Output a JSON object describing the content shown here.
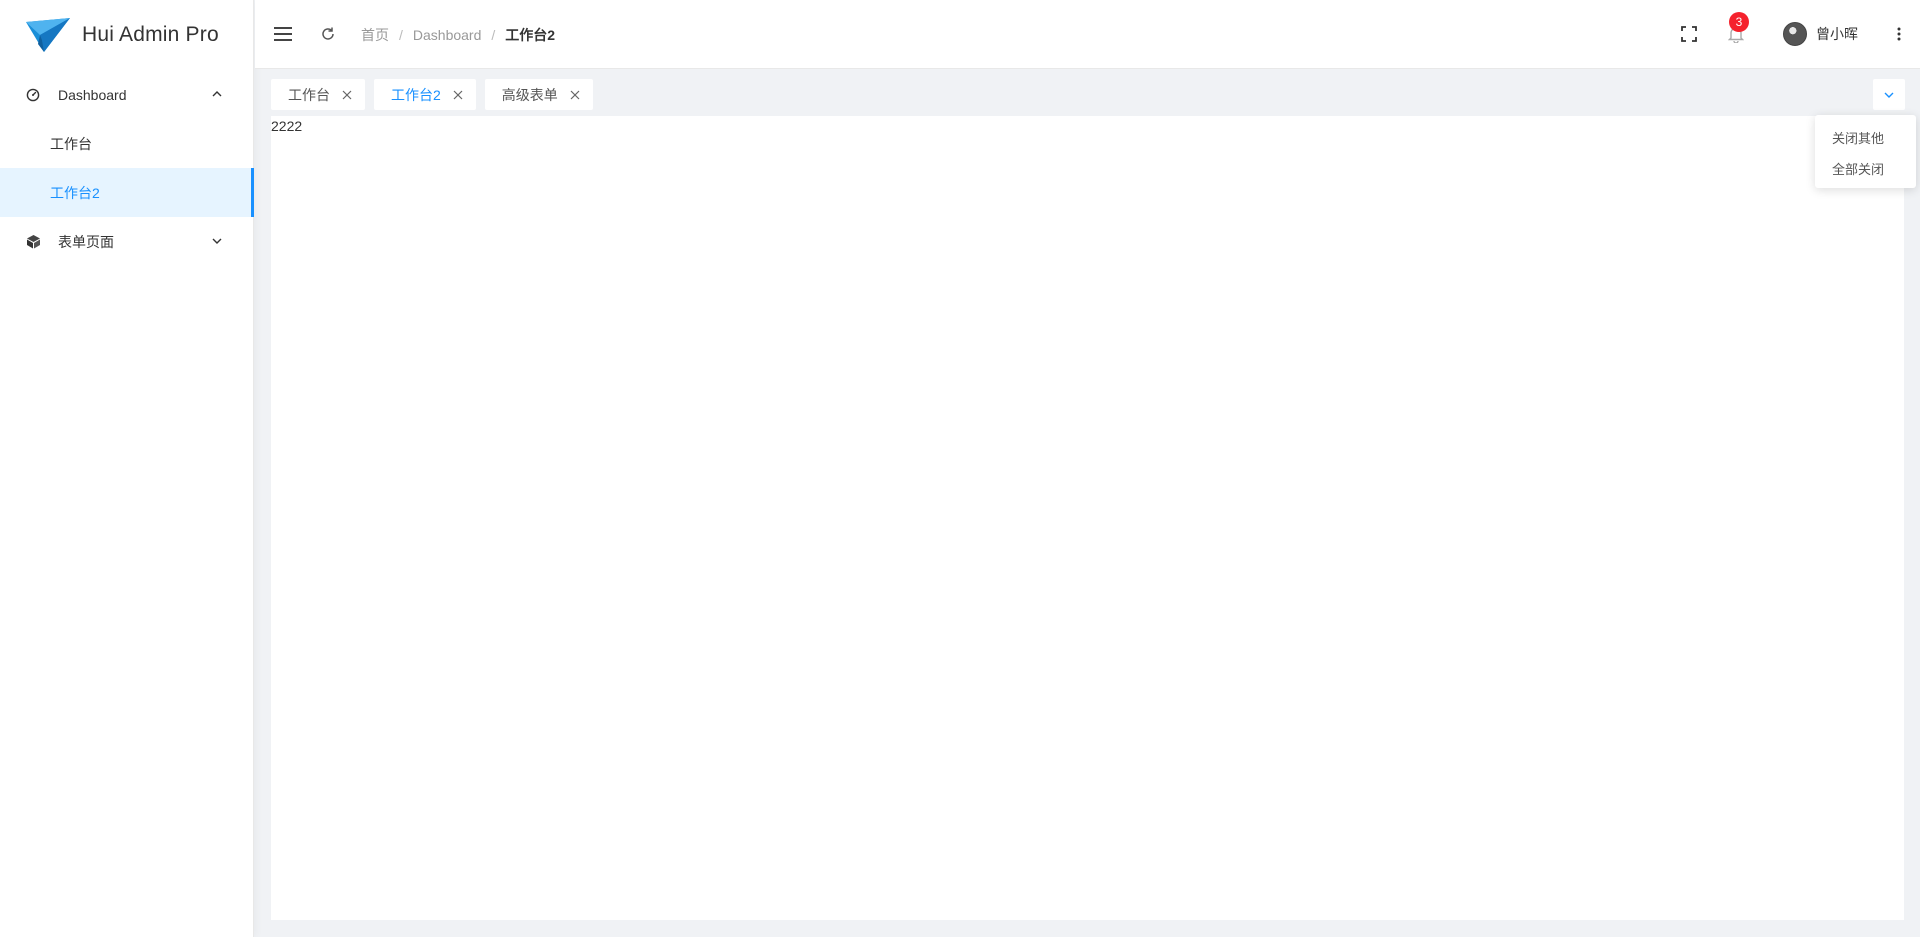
{
  "app": {
    "brand_name": "Hui Admin Pro"
  },
  "sidebar": {
    "groups": [
      {
        "label": "Dashboard",
        "icon": "dashboard-icon",
        "expanded": true,
        "items": [
          {
            "label": "工作台",
            "active": false
          },
          {
            "label": "工作台2",
            "active": true
          }
        ]
      },
      {
        "label": "表单页面",
        "icon": "cube-icon",
        "expanded": false,
        "items": []
      }
    ]
  },
  "header": {
    "breadcrumb": [
      "首页",
      "Dashboard",
      "工作台2"
    ],
    "notification_count": "3",
    "user_name": "曾小晖"
  },
  "tabs": [
    {
      "label": "工作台",
      "active": false
    },
    {
      "label": "工作台2",
      "active": true
    },
    {
      "label": "高级表单",
      "active": false
    }
  ],
  "tab_menu": {
    "items": [
      "关闭其他",
      "全部关闭"
    ]
  },
  "content": {
    "text": "2222"
  },
  "colors": {
    "accent": "#1890ff",
    "active_bg": "#e6f4ff",
    "badge": "#f5222d",
    "page_bg": "#f0f2f5"
  }
}
